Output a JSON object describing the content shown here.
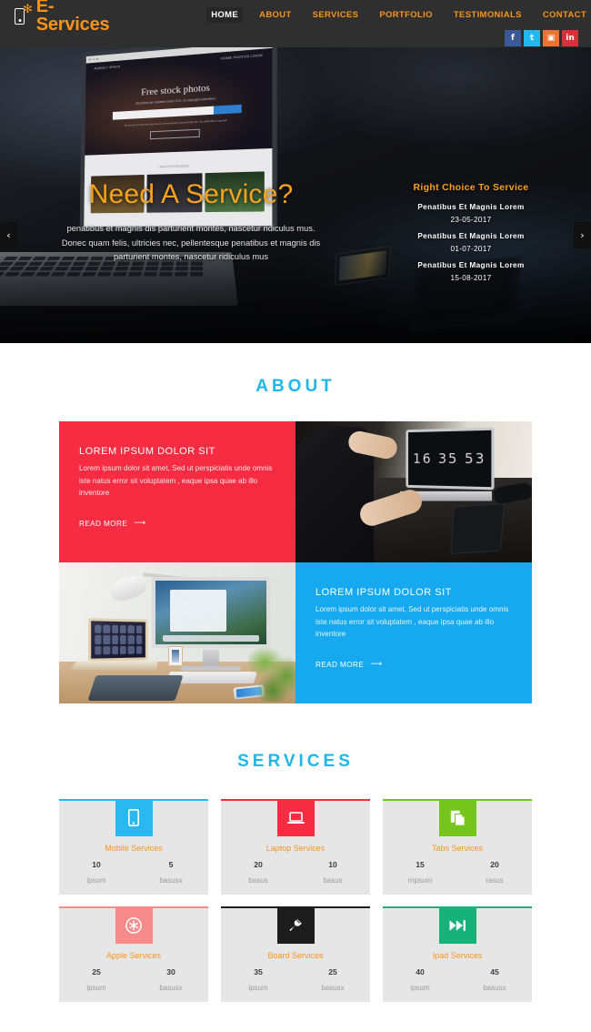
{
  "header": {
    "logo_text": "E-Services",
    "logo_icons": [
      "mobile-phone-icon",
      "gear-icon"
    ],
    "nav": [
      {
        "label": "HOME",
        "active": true
      },
      {
        "label": "ABOUT",
        "active": false
      },
      {
        "label": "SERVICES",
        "active": false
      },
      {
        "label": "PORTFOLIO",
        "active": false
      },
      {
        "label": "TESTIMONIALS",
        "active": false
      },
      {
        "label": "CONTACT",
        "active": false
      }
    ],
    "social": [
      {
        "name": "facebook",
        "glyph": "f",
        "color": "#3b5998"
      },
      {
        "name": "twitter",
        "glyph": "t",
        "color": "#22b8f0"
      },
      {
        "name": "instagram",
        "glyph": "▣",
        "color": "#ef7330"
      },
      {
        "name": "linkedin",
        "glyph": "in",
        "color": "#d9303a"
      }
    ],
    "bg_color": "#2f2f2f",
    "accent_color": "#f7941e"
  },
  "hero": {
    "title": "Need A Service?",
    "description": "penatibus et magnis dis parturient montes, nascetur ridiculus mus. Donec quam felis, ultricies nec, pellentesque penatibus et magnis dis parturient montes, nascetur ridiculus mus",
    "prev_arrow": "‹",
    "next_arrow": "›",
    "side": {
      "title": "Right Choice To Service",
      "items": [
        {
          "label": "Penatibus Et Magnis Lorem",
          "date": "23-05-2017"
        },
        {
          "label": "Penatibus Et Magnis Lorem",
          "date": "01-07-2017"
        },
        {
          "label": "Penatibus Et Magnis Lorem",
          "date": "15-08-2017"
        }
      ]
    },
    "laptop_screen": {
      "brand": "AGENCY SPACE",
      "nav": "HOME   PHOTOS   LOGIN",
      "title": "Free stock photos",
      "subtitle": "All photos are released under CC0. no copyright restrictions",
      "note": "All photos on this site are free for personal and commercial use. No attribution required.",
      "button": "Browse free courses",
      "body_title": "NEW PHOTOS ADDED"
    }
  },
  "about": {
    "title": "ABOUT",
    "panels": [
      {
        "heading": "LOREM IPSUM DOLOR SIT",
        "text": "Lorem ipsum dolor sit amet, Sed ut perspiciatis unde omnis iste natus error sit voluptatem , eaque ipsa quae ab illo inventore",
        "read_more": "READ MORE",
        "arrow": "➡",
        "color": "#f72c42"
      },
      {
        "heading": "LOREM IPSUM DOLOR SIT",
        "text": "Lorem ipsum dolor sit amet, Sed ut perspiciatis unde omnis iste natus error sit voluptatem , eaque ipsa quae ab illo inventore",
        "read_more": "READ MORE",
        "arrow": "➡",
        "color": "#16a9f0"
      }
    ],
    "photo_top_right": "person-at-desk-with-laptop-showing-16-35-53",
    "photo_bottom_left": "bright-desk-with-imac-laptop-and-lamp",
    "laptop_clock": "16 35 53"
  },
  "services": {
    "title": "SERVICES",
    "cards": [
      {
        "name": "Mobile Services",
        "icon": "mobile-phone-icon",
        "color": "#29b9f0",
        "stats": [
          {
            "num": "10",
            "label": "ipsum"
          },
          {
            "num": "5",
            "label": "basusx"
          }
        ]
      },
      {
        "name": "Laptop Services",
        "icon": "laptop-icon",
        "color": "#f72c42",
        "stats": [
          {
            "num": "20",
            "label": "basus"
          },
          {
            "num": "10",
            "label": "basus"
          }
        ]
      },
      {
        "name": "Tabs Services",
        "icon": "tabs-document-icon",
        "color": "#76c51c",
        "stats": [
          {
            "num": "15",
            "label": "mpsum"
          },
          {
            "num": "20",
            "label": "rasus"
          }
        ]
      },
      {
        "name": "Apple Services",
        "icon": "asterisk-circle-icon",
        "color": "#f78b8b",
        "stats": [
          {
            "num": "25",
            "label": "ipsum"
          },
          {
            "num": "30",
            "label": "basusx"
          }
        ]
      },
      {
        "name": "Board Services",
        "icon": "power-plug-icon",
        "color": "#1c1c1c",
        "stats": [
          {
            "num": "35",
            "label": "ipsum"
          },
          {
            "num": "25",
            "label": "basusx"
          }
        ]
      },
      {
        "name": "Ipad Services",
        "icon": "fast-forward-icon",
        "color": "#17b27b",
        "stats": [
          {
            "num": "40",
            "label": "ipsum"
          },
          {
            "num": "45",
            "label": "basusx"
          }
        ]
      }
    ]
  }
}
